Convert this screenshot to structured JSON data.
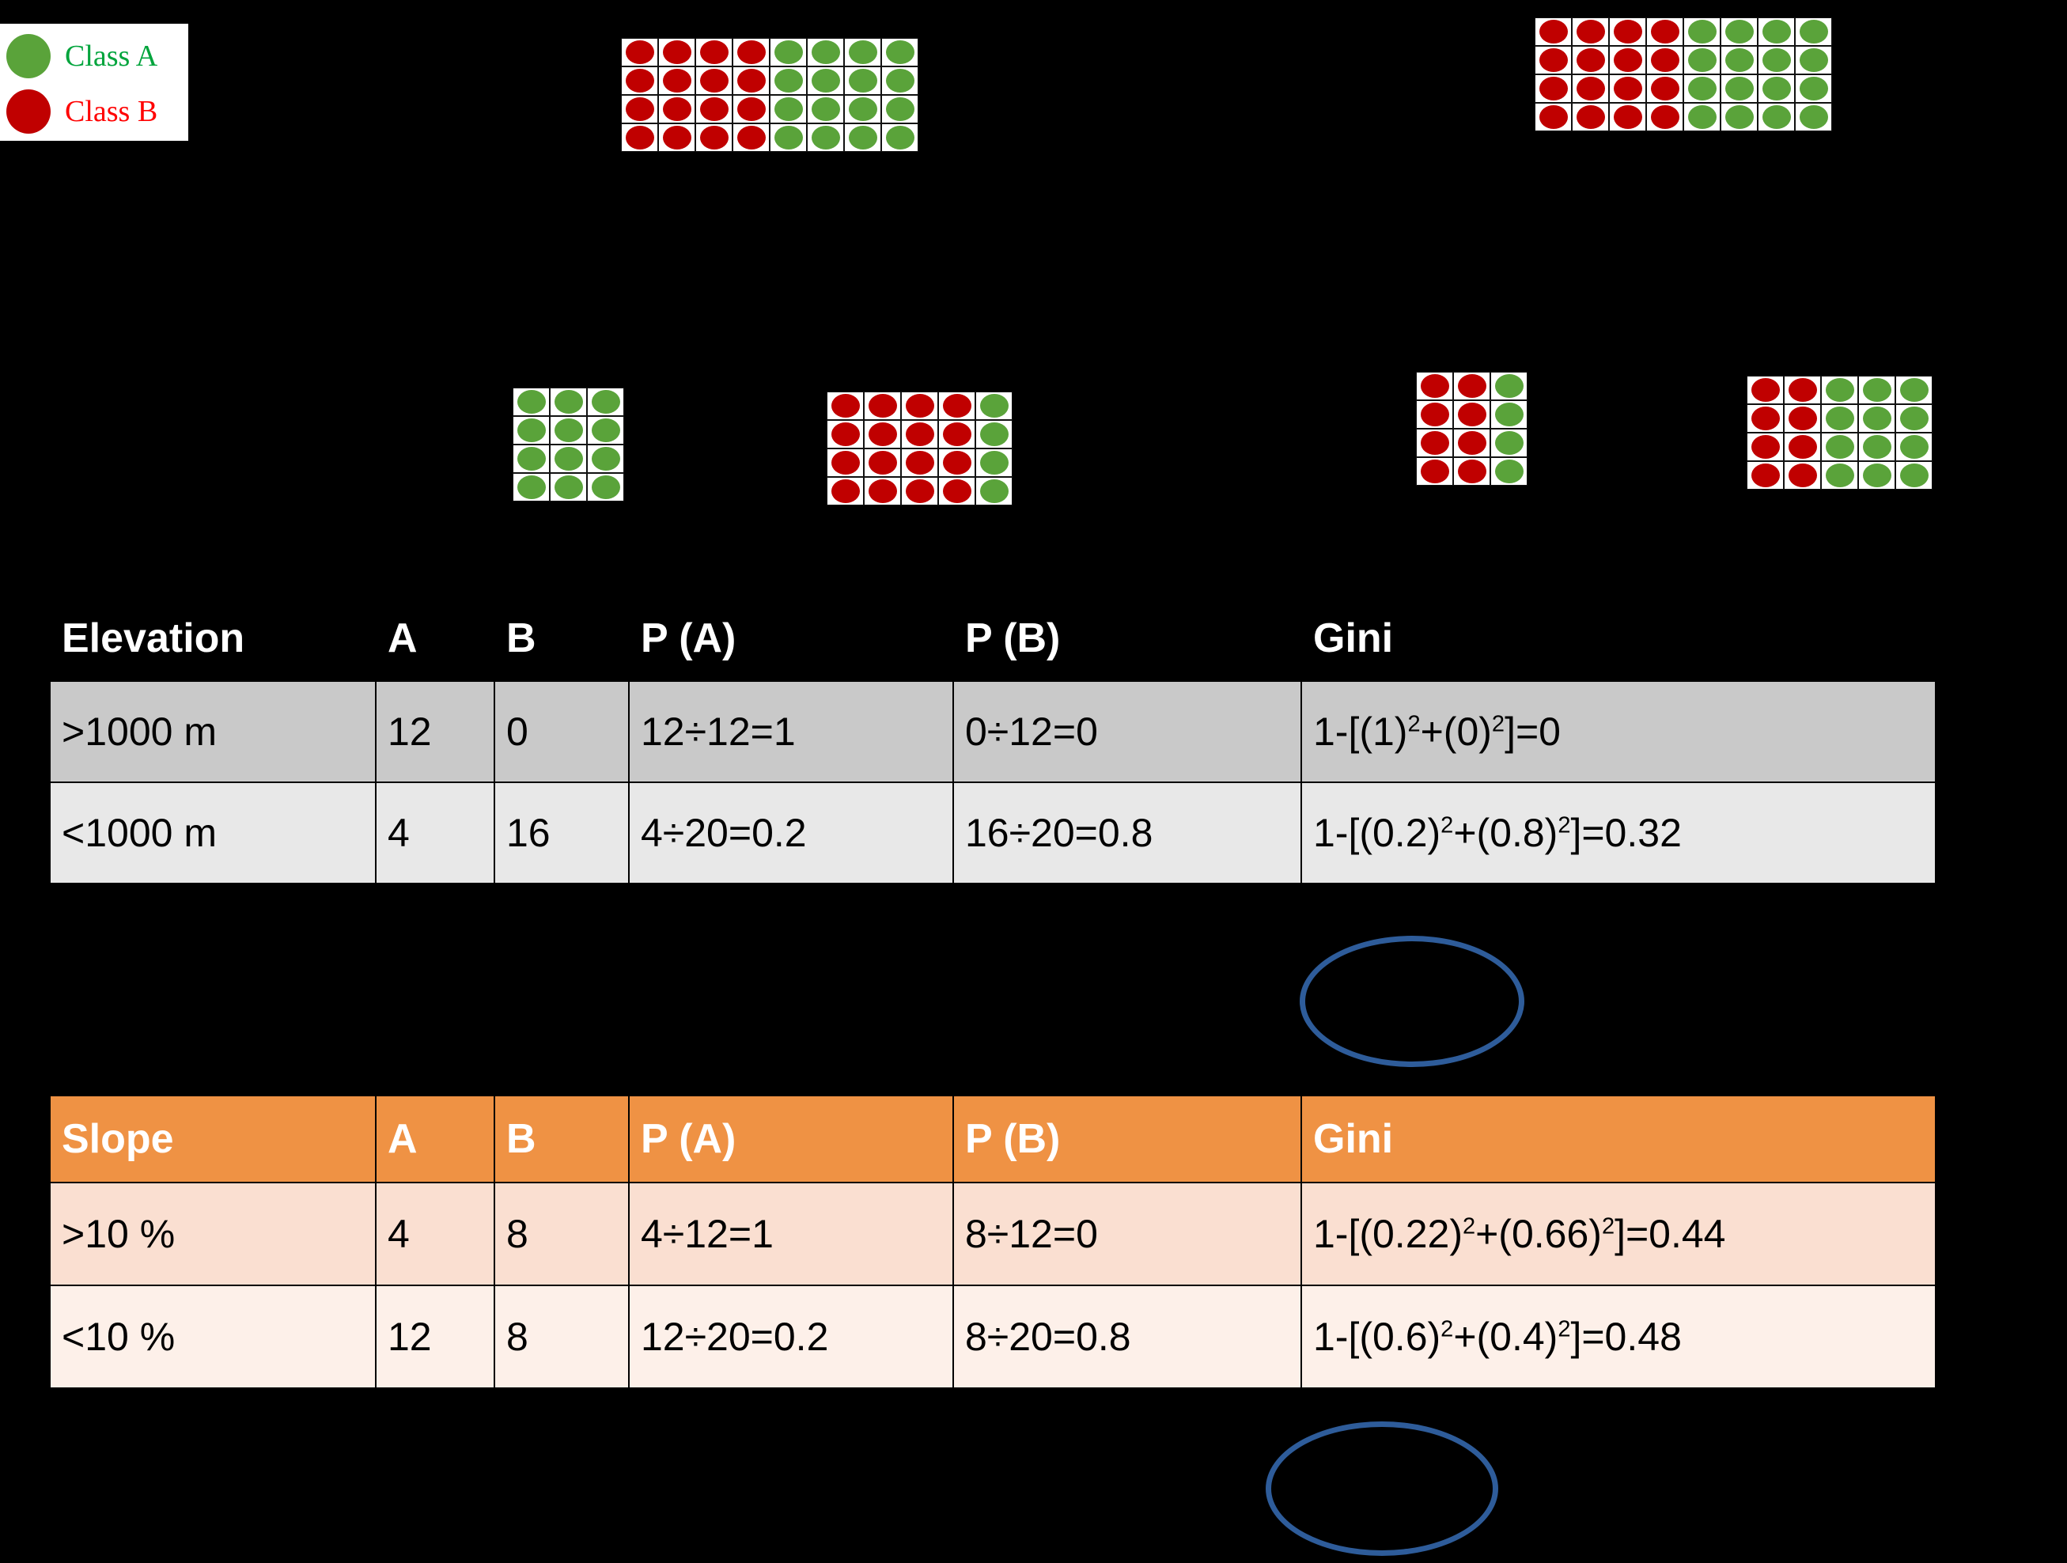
{
  "legend": {
    "items": [
      {
        "label": "Class A",
        "color": "#5aa33a",
        "text_color": "#00a43c"
      },
      {
        "label": "Class B",
        "color": "#c00000",
        "text_color": "#ff0000"
      }
    ]
  },
  "colors": {
    "class_a_green": "#5aa33a",
    "class_b_red": "#c00000",
    "header_black": "#000000",
    "header_orange": "#ef9244",
    "row_grey_dark": "#c9c9c9",
    "row_grey_light": "#e8e8e8",
    "row_peach_dark": "#fadfd1",
    "row_peach_light": "#fdf0e9",
    "ellipse_blue": "#2e5c9a",
    "background": "#000000"
  },
  "dot_grids": [
    {
      "name": "root-node-top-center",
      "rows": 4,
      "columns": [
        "B",
        "B",
        "B",
        "B",
        "A",
        "A",
        "A",
        "A"
      ],
      "count_a": 16,
      "count_b": 16
    },
    {
      "name": "root-node-top-right",
      "rows": 4,
      "columns": [
        "B",
        "B",
        "B",
        "B",
        "A",
        "A",
        "A",
        "A"
      ],
      "count_a": 16,
      "count_b": 16
    },
    {
      "name": "elevation-above-1000m",
      "rows": 4,
      "columns": [
        "A",
        "A",
        "A"
      ],
      "count_a": 12,
      "count_b": 0
    },
    {
      "name": "elevation-below-1000m",
      "rows": 4,
      "columns": [
        "B",
        "B",
        "B",
        "B",
        "A"
      ],
      "count_a": 4,
      "count_b": 16
    },
    {
      "name": "slope-above-10pct",
      "rows": 4,
      "columns": [
        "B",
        "B",
        "A"
      ],
      "count_a": 4,
      "count_b": 8
    },
    {
      "name": "slope-below-10pct",
      "rows": 4,
      "columns": [
        "B",
        "B",
        "A",
        "A",
        "A"
      ],
      "count_a": 12,
      "count_b": 8
    }
  ],
  "table_elevation": {
    "headers": [
      "Elevation",
      "A",
      "B",
      "P (A)",
      "P (B)",
      "Gini"
    ],
    "rows": [
      {
        "split": ">1000 m",
        "a": "12",
        "b": "0",
        "pa": "12÷12=1",
        "pb": "0÷12=0",
        "gini_pre": "1-[(1)",
        "gini_sup1": "2",
        "gini_mid": "+(0)",
        "gini_sup2": "2",
        "gini_post": "]=0"
      },
      {
        "split": "<1000 m",
        "a": "4",
        "b": "16",
        "pa": "4÷20=0.2",
        "pb": "16÷20=0.8",
        "gini_pre": "1-[(0.2)",
        "gini_sup1": "2",
        "gini_mid": "+(0.8)",
        "gini_sup2": "2",
        "gini_post": "]=0.32"
      }
    ]
  },
  "table_slope": {
    "headers": [
      "Slope",
      "A",
      "B",
      "P (A)",
      "P (B)",
      "Gini"
    ],
    "rows": [
      {
        "split": ">10 %",
        "a": "4",
        "b": "8",
        "pa": "4÷12=1",
        "pb": "8÷12=0",
        "gini_pre": "1-[(0.22)",
        "gini_sup1": "2",
        "gini_mid": "+(0.66)",
        "gini_sup2": "2",
        "gini_post": "]=0.44"
      },
      {
        "split": "<10 %",
        "a": "12",
        "b": "8",
        "pa": "12÷20=0.2",
        "pb": "8÷20=0.8",
        "gini_pre": "1-[(0.6)",
        "gini_sup1": "2",
        "gini_mid": "+(0.4)",
        "gini_sup2": "2",
        "gini_post": "]=0.48"
      }
    ]
  },
  "annotations": [
    {
      "name": "ellipse-below-elevation-table",
      "shape": "ellipse"
    },
    {
      "name": "ellipse-below-slope-table",
      "shape": "ellipse"
    }
  ]
}
